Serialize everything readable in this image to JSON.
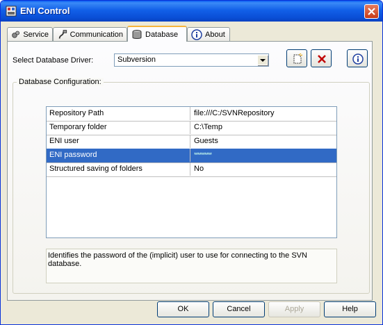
{
  "window": {
    "title": "ENI Control"
  },
  "tabs": [
    {
      "label": "Service",
      "icon": "gears-icon"
    },
    {
      "label": "Communication",
      "icon": "plug-icon"
    },
    {
      "label": "Database",
      "icon": "database-icon",
      "active": true
    },
    {
      "label": "About",
      "icon": "info-icon"
    }
  ],
  "driver": {
    "label": "Select Database Driver:",
    "selected": "Subversion"
  },
  "toolbar": {
    "new_icon": "new-document-icon",
    "delete_icon": "red-x-icon",
    "info_icon": "info-icon"
  },
  "config": {
    "group_label": "Database Configuration:",
    "rows": [
      {
        "name": "Repository Path",
        "value": "file:///C:/SVNRepository"
      },
      {
        "name": "Temporary folder",
        "value": "C:\\Temp"
      },
      {
        "name": "ENI user",
        "value": "Guests"
      },
      {
        "name": "ENI password",
        "value": "**********",
        "selected": true
      },
      {
        "name": "Structured saving of folders",
        "value": "No"
      }
    ],
    "description": "Identifies the password of the (implicit) user to use for connecting to the SVN database."
  },
  "buttons": {
    "ok": "OK",
    "cancel": "Cancel",
    "apply": "Apply",
    "help": "Help"
  },
  "colors": {
    "title_bar": "#0a5cf2",
    "selection": "#316ac5",
    "delete_red": "#c00000"
  }
}
